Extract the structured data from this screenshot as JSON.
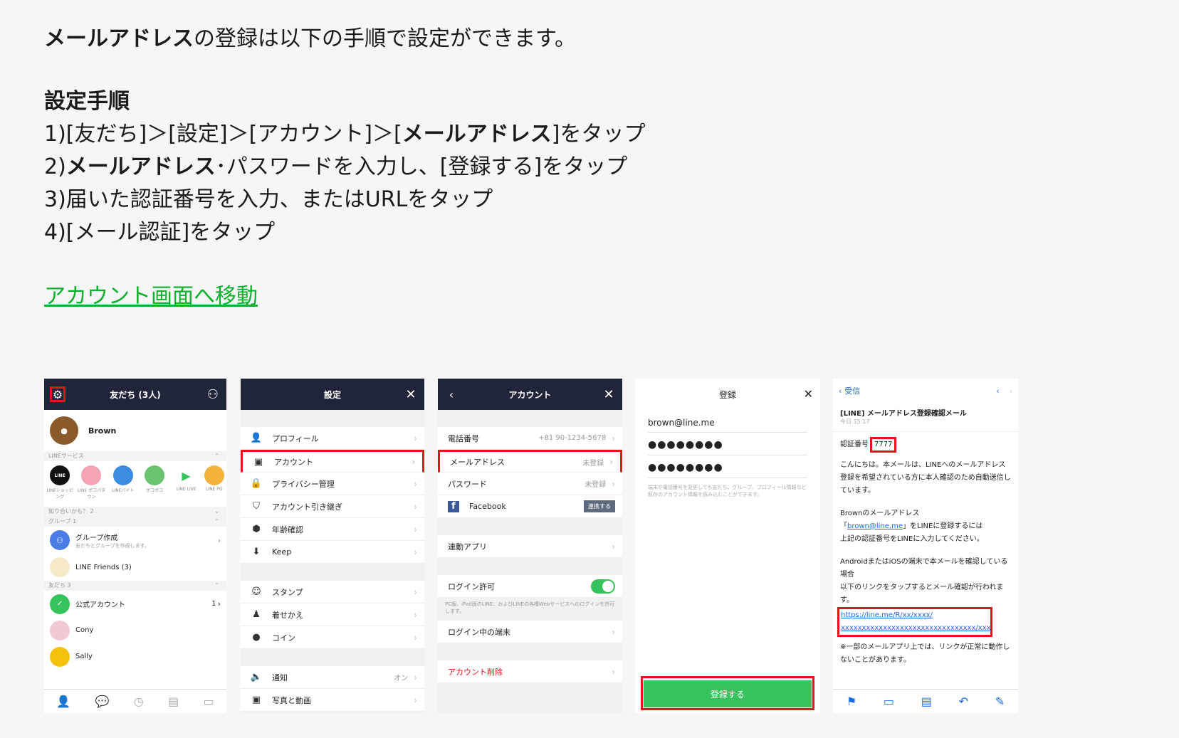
{
  "intro": {
    "bold": "メールアドレス",
    "rest": "の登録は以下の手順で設定ができます。"
  },
  "steps_title": "設定手順",
  "steps": {
    "s1_pre": "1)[友だち]＞[設定]＞[アカウント]＞[",
    "s1_bold": "メールアドレス",
    "s1_post": "]をタップ",
    "s2_pre": "2)",
    "s2_bold": "メールアドレス",
    "s2_post": "･パスワードを入力し、[登録する]をタップ",
    "s3": "3)届いた認証番号を入力、またはURLをタップ",
    "s4": "4)[メール認証]をタップ"
  },
  "link_text": "アカウント画面へ移動",
  "screen1": {
    "title": "友だち (3人)",
    "profile_name": "Brown",
    "sec_line_services": "LINEサービス",
    "services": [
      "LINEショッピング",
      "LINE ポコパタウン",
      "LINEバイト",
      "ポコポコ",
      "LINE LIVE",
      "LINE PO"
    ],
    "sec_maybe": "知り合いかも？ 2",
    "sec_groups": "グループ 1",
    "group_create": "グループ作成",
    "group_create_sub": "友だちとグループを作成します。",
    "line_friends": "LINE Friends  (3)",
    "sec_friends": "友だち 3",
    "official": "公式アカウント",
    "official_count": "1",
    "friend1": "Cony",
    "friend2": "Sally"
  },
  "screen2": {
    "title": "設定",
    "items1": [
      "プロフィール",
      "アカウント",
      "プライバシー管理",
      "アカウント引き継ぎ",
      "年齢確認",
      "Keep"
    ],
    "items2": [
      "スタンプ",
      "着せかえ",
      "コイン"
    ],
    "items3": [
      "通知",
      "写真と動画"
    ],
    "notify_val": "オン"
  },
  "screen3": {
    "title": "アカウント",
    "phone_label": "電話番号",
    "phone_val": "+81 90-1234-5678",
    "mail_label": "メールアドレス",
    "mail_val": "未登録",
    "pass_label": "パスワード",
    "pass_val": "未登録",
    "fb_label": "Facebook",
    "fb_btn": "連携する",
    "apps": "連動アプリ",
    "login_allow": "ログイン許可",
    "login_note": "PC版、iPad版のLINE、およびLINEの各種Webサービスへのログインを許可します。",
    "devices": "ログイン中の端末",
    "delete": "アカウント削除"
  },
  "screen4": {
    "title": "登録",
    "email": "brown@line.me",
    "pw1": "●●●●●●●●",
    "pw2": "●●●●●●●●",
    "note": "端末や電話番号を変更しても友だち、グループ、プロフィール情報など既存のアカウント情報を読み込むことができます。",
    "button": "登録する"
  },
  "screen5": {
    "back": "受信",
    "subject": "[LINE] メールアドレス登録確認メール",
    "date": "今日 15:17",
    "code_label": "認証番号",
    "code": "7777",
    "p1": "こんにちは。本メールは、LINEへのメールアドレス登録を希望されている方に本人確認のため自動送信しています。",
    "p2a": "Brownのメールアドレス",
    "p2b_pre": "「",
    "p2b_link": "brown@line.me",
    "p2b_post": "」をLINEに登録するには",
    "p2c": "上記の認証番号をLINEに入力してください。",
    "p3": "AndroidまたはiOSの端末で本メールを確認している場合",
    "p4": "以下のリンクをタップするとメール確認が行われます。",
    "url1": "https://line.me/R/xx/xxxx/",
    "url2": "xxxxxxxxxxxxxxxxxxxxxxxxxxxxxxxx/xxxx",
    "p5": "※一部のメールアプリ上では、リンクが正常に動作しないことがあります。"
  }
}
